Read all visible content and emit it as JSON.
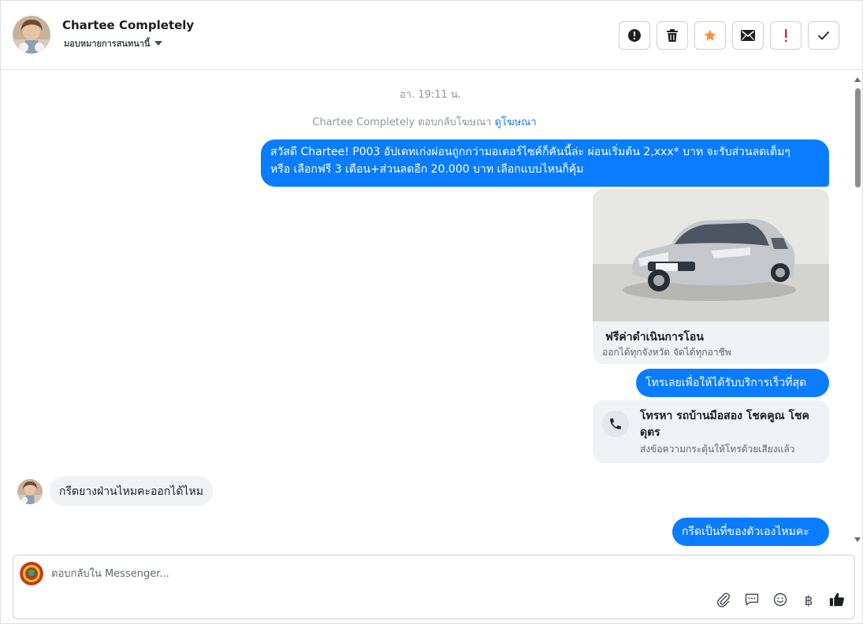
{
  "header": {
    "contact_name": "Chartee Completely",
    "assign_label": "มอบหมายการสนทนานี้"
  },
  "toolbar": {
    "buttons": [
      {
        "icon": "info-alert-icon"
      },
      {
        "icon": "trash-icon"
      },
      {
        "icon": "star-icon",
        "color": "#f7923a"
      },
      {
        "icon": "envelope-icon"
      },
      {
        "icon": "exclamation-icon",
        "color": "#e41e3f"
      },
      {
        "icon": "check-icon"
      }
    ]
  },
  "conversation": {
    "timestamp": "อา. 19:11 น.",
    "ad_reply_prefix": "Chartee Completely ตอบกลับโฆษณา",
    "ad_reply_link": "ดูโฆษณา",
    "msg1_line1": "สวัสดี Chartee! P003 อัปเดทเก่งผ่อนถูกกว่ามอเตอร์ไซค์ก็คันนี้ล่ะ ผ่อนเริ่มต้น 2,xxx* บาท จะรับส่วนลดเต็มๆ",
    "msg1_line2": "หรือ เลือกฟรี 3 เดือน+ส่วนลดอีก 20.000 บาท เลือกแบบไหนก็คุ้ม",
    "card": {
      "title": "ฟรีค่าดำเนินการโอน",
      "subtitle": "ออกได้ทุกจังหวัด จัดได้ทุกอาชีพ",
      "plate": "กข 4782"
    },
    "msg2": "โทรเลยเพื่อให้ได้รับบริการเร็วที่สุด",
    "call_card": {
      "title": "โทรหา รถบ้านมือสอง โชคคูณ โชคดุตร",
      "subtitle": "ส่งข้อความกระตุ้นให้โทรด้วยเสียงแล้ว"
    },
    "incoming_msg": "กรีดยางฝ่านไหมคะออกได้ไหม",
    "msg3": "กรีดเป็นที่ของตัวเองไหมคะ"
  },
  "composer": {
    "placeholder": "ตอบกลับใน Messenger...",
    "tools": [
      "paperclip-icon",
      "saved-reply-icon",
      "emoji-icon",
      "baht-icon",
      "thumbs-up-icon"
    ],
    "baht_symbol": "฿"
  },
  "colors": {
    "outgoing_bubble": "#0a7cff",
    "incoming_bubble": "#f0f2f5",
    "link": "#1877f2"
  }
}
